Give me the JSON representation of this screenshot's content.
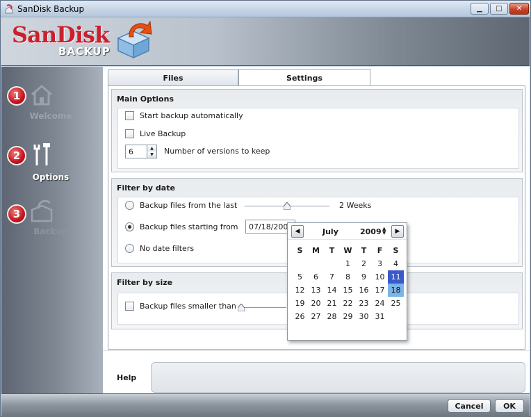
{
  "window": {
    "title": "SanDisk Backup",
    "controls": {
      "minimize": "▁",
      "maximize": "□",
      "close": "✕"
    }
  },
  "header": {
    "brand": "SanDisk",
    "product": "BACKUP",
    "icon": "backup-box-arrow-icon",
    "brand_color": "#cc1f2d"
  },
  "sidebar": {
    "steps": [
      {
        "number": "1",
        "label": "Welcome",
        "icon": "house-icon",
        "active": false
      },
      {
        "number": "2",
        "label": "Options",
        "icon": "tools-icon",
        "active": true
      },
      {
        "number": "3",
        "label": "Backup",
        "icon": "backup-box-icon",
        "active": false
      }
    ]
  },
  "tabs": [
    {
      "label": "Files",
      "selected": false
    },
    {
      "label": "Settings",
      "selected": true
    }
  ],
  "main_options": {
    "title": "Main Options",
    "start_auto": {
      "label": "Start backup automatically",
      "checked": false
    },
    "live_backup": {
      "label": "Live Backup",
      "checked": false
    },
    "versions": {
      "value": "6",
      "label": "Number of versions to keep"
    }
  },
  "filter_date": {
    "title": "Filter by date",
    "from_last": {
      "label": "Backup files from the last",
      "selected": false,
      "slider_fraction": 0.5,
      "value_label": "2 Weeks"
    },
    "starting_from": {
      "label": "Backup files starting from",
      "selected": true,
      "date": "07/18/2009"
    },
    "no_filter": {
      "label": "No date filters",
      "selected": false
    }
  },
  "filter_size": {
    "title": "Filter by size",
    "smaller_than": {
      "label": "Backup files smaller than",
      "checked": false,
      "slider_fraction": 0.0
    }
  },
  "calendar": {
    "month": "July",
    "year": "2009",
    "prev": "◀",
    "next": "▶",
    "year_spin": "▲▼",
    "weekdays": [
      "S",
      "M",
      "T",
      "W",
      "T",
      "F",
      "S"
    ],
    "weeks": [
      [
        "",
        "",
        "",
        "1",
        "2",
        "3",
        "4"
      ],
      [
        "5",
        "6",
        "7",
        "8",
        "9",
        "10",
        "11"
      ],
      [
        "12",
        "13",
        "14",
        "15",
        "16",
        "17",
        "18"
      ],
      [
        "19",
        "20",
        "21",
        "22",
        "23",
        "24",
        "25"
      ],
      [
        "26",
        "27",
        "28",
        "29",
        "30",
        "31",
        ""
      ]
    ],
    "selected_day": "11",
    "highlight_day": "18",
    "selected_color": "#3b59c9",
    "highlight_color": "#7ab4e8"
  },
  "help": {
    "label": "Help",
    "text": ""
  },
  "footer": {
    "cancel": "Cancel",
    "ok": "OK"
  }
}
